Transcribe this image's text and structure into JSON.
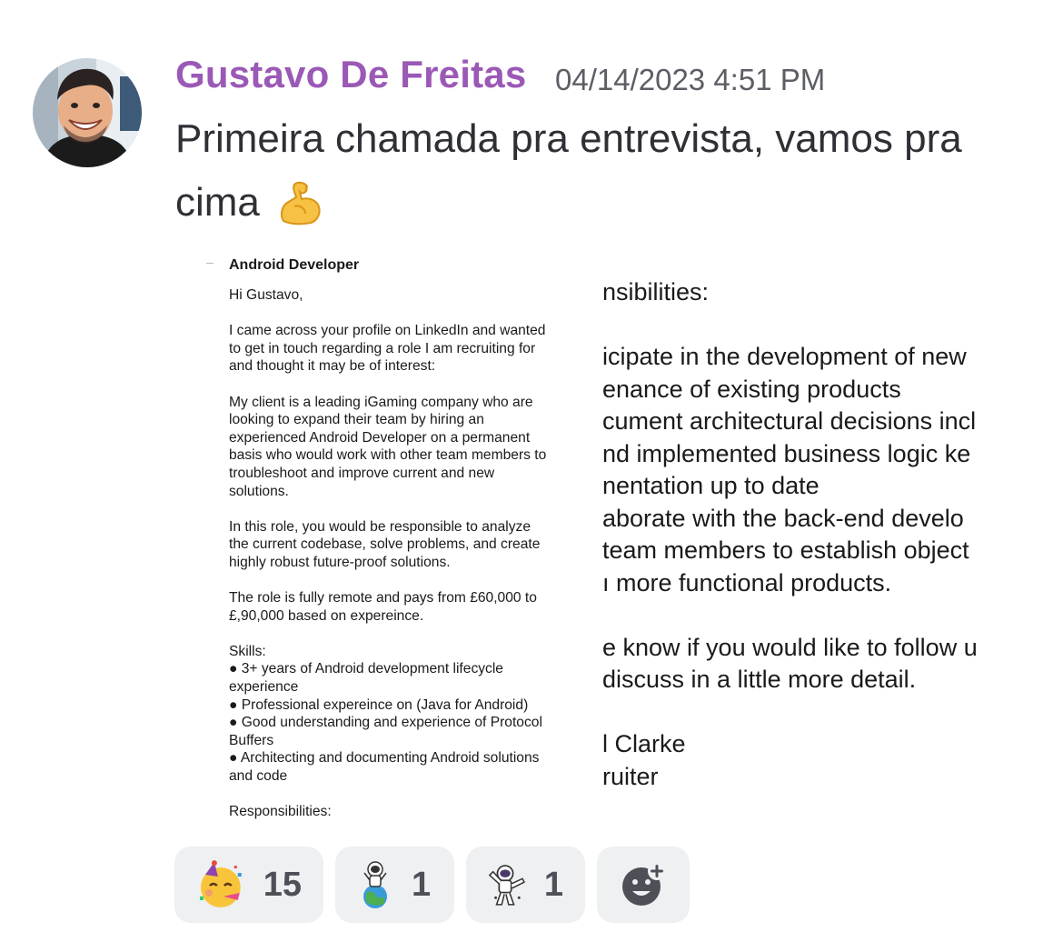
{
  "message": {
    "author": "Gustavo De Freitas",
    "timestamp": "04/14/2023 4:51 PM",
    "text": "Primeira chamada pra entrevista, vamos pra cima",
    "emoji": "flexed-biceps-icon",
    "author_color": "#9b59b6"
  },
  "attachment": {
    "left_title": "Android Developer",
    "left_paragraphs": [
      "Hi Gustavo,",
      "I came across your profile on LinkedIn and wanted\nto get in touch regarding a role I am recruiting for\nand thought it may be of interest:",
      "My client is a leading iGaming company who are\nlooking to expand their team by hiring an\nexperienced Android Developer on a permanent\nbasis who would work with other team members to\ntroubleshoot and improve current and new\nsolutions.",
      "In this role, you would be responsible to analyze\nthe current codebase, solve problems, and create\nhighly robust future-proof solutions.",
      "The role is fully remote and pays from £60,000 to\n£,90,000 based on expereince.",
      "Skills:\n● 3+ years of Android development lifecycle\nexperience\n● Professional expereince on (Java for Android)\n● Good understanding and experience of Protocol\nBuffers\n● Architecting and documenting Android solutions\nand code",
      "Responsibilities:"
    ],
    "right_lines": [
      "nsibilities:",
      "",
      "icipate in the development of new",
      "enance of existing products",
      "cument architectural decisions incl",
      "nd implemented business logic ke",
      "nentation up to date",
      "aborate with the back-end develo",
      "team members to establish object",
      "ı more functional  products.",
      "",
      "e know if you would like to follow u",
      "discuss in a little more detail.",
      "",
      "l Clarke",
      "ruiter"
    ]
  },
  "reactions": [
    {
      "icon": "partying-face-icon",
      "count": "15"
    },
    {
      "icon": "astronaut-on-globe-icon",
      "count": "1"
    },
    {
      "icon": "dabbing-astronaut-icon",
      "count": "1"
    },
    {
      "icon": "add-reaction-icon"
    }
  ]
}
